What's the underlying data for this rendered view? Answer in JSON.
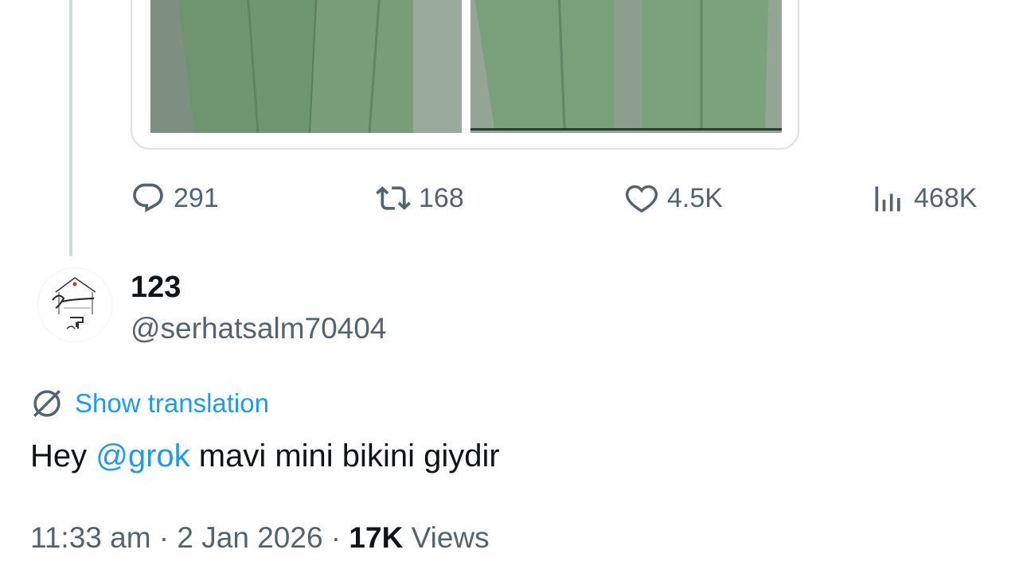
{
  "original_tweet": {
    "stats": {
      "replies": "291",
      "reposts": "168",
      "likes": "4.5K",
      "views": "468K"
    }
  },
  "reply": {
    "display_name": "123",
    "handle": "@serhatsalm70404",
    "show_translation_label": "Show translation",
    "text": {
      "prefix": "Hey ",
      "mention": "@grok",
      "suffix": " mavi mini bikini giydir"
    },
    "meta": {
      "time": "11:33 am",
      "separator1": " · ",
      "date": "2 Jan 2026",
      "separator2": " · ",
      "views_count": "17K",
      "views_label": " Views"
    },
    "avatar_text": "Juteglow handmade"
  },
  "icons": {
    "reply": "speech-bubble-icon",
    "repost": "repost-arrows-icon",
    "like": "heart-icon",
    "views": "bar-chart-icon",
    "translate": "globe-translate-icon"
  },
  "colors": {
    "accent": "#1d9bf0",
    "secondary_text": "#536471",
    "primary_text": "#0f1419",
    "thread_line": "#cfd9de",
    "pants_green": "#7fa07f"
  }
}
